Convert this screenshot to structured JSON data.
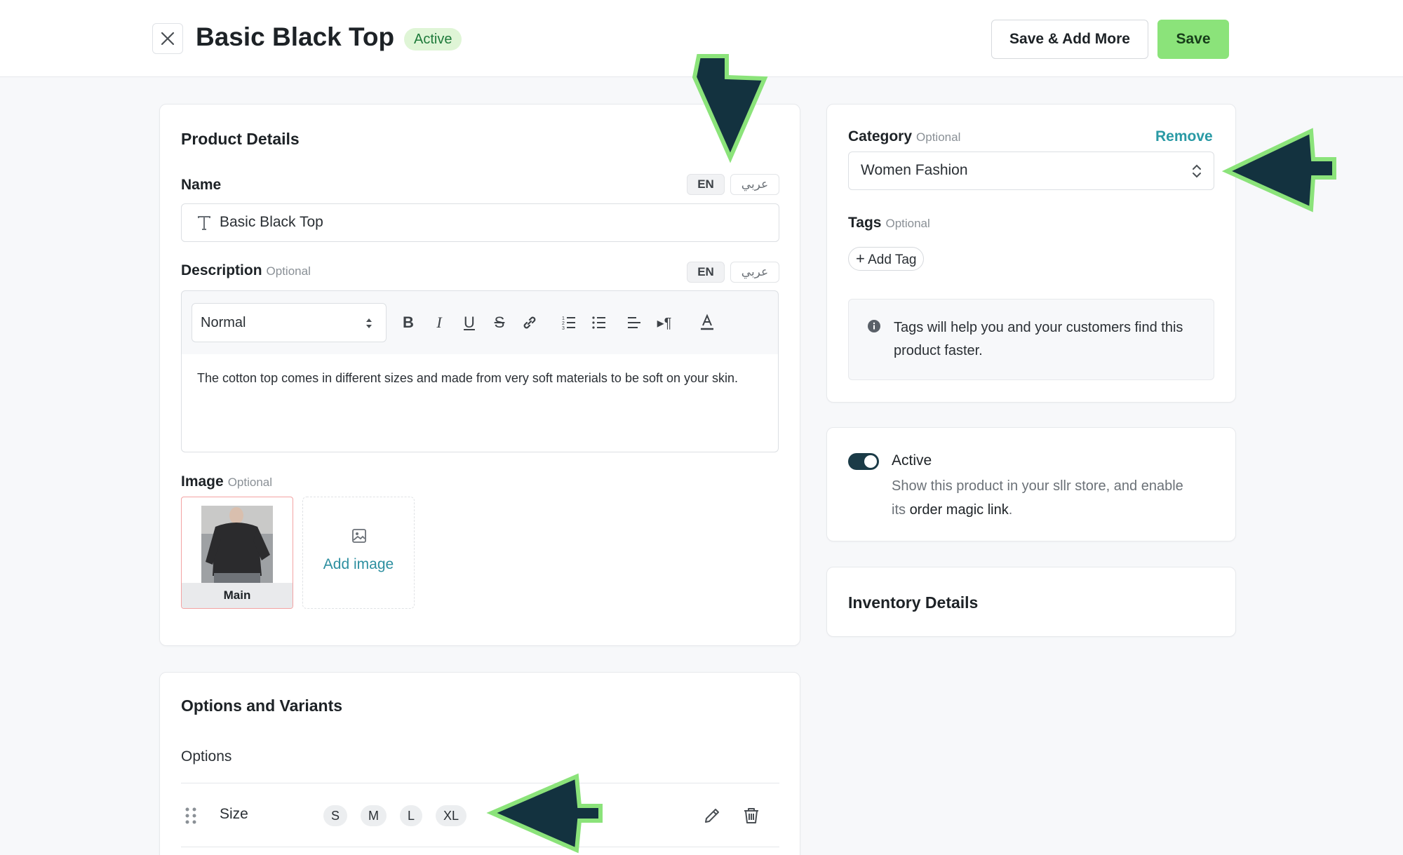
{
  "header": {
    "title": "Basic Black Top",
    "status": "Active",
    "save_add_more_label": "Save & Add More",
    "save_label": "Save"
  },
  "product_details": {
    "title": "Product Details",
    "name_label": "Name",
    "lang_en": "EN",
    "lang_ar": "عربي",
    "name_value": "Basic Black Top",
    "description_label": "Description",
    "optional": "Optional",
    "format_select": "Normal",
    "description_text": "The cotton top comes in different sizes and made from very soft materials to be soft on your skin.",
    "image_label": "Image",
    "main_image_label": "Main",
    "add_image_label": "Add image"
  },
  "options": {
    "title": "Options and Variants",
    "subtitle": "Options",
    "option_name": "Size",
    "values": [
      "S",
      "M",
      "L",
      "XL"
    ]
  },
  "category": {
    "label": "Category",
    "optional": "Optional",
    "remove_label": "Remove",
    "value": "Women Fashion"
  },
  "tags": {
    "label": "Tags",
    "optional": "Optional",
    "add_tag_label": "Add Tag",
    "info_text": "Tags will help you and your customers find this product faster."
  },
  "visibility": {
    "label": "Active",
    "desc_prefix": "Show this product in your sllr store, and enable its ",
    "desc_link": "order magic link",
    "desc_suffix": "."
  },
  "inventory": {
    "title": "Inventory Details"
  },
  "colors": {
    "accent_green": "#8be37a",
    "arrow_fill": "#13323f",
    "arrow_stroke": "#8be37a",
    "link_teal": "#2a9aa5",
    "status_bg": "#dff5d6"
  }
}
